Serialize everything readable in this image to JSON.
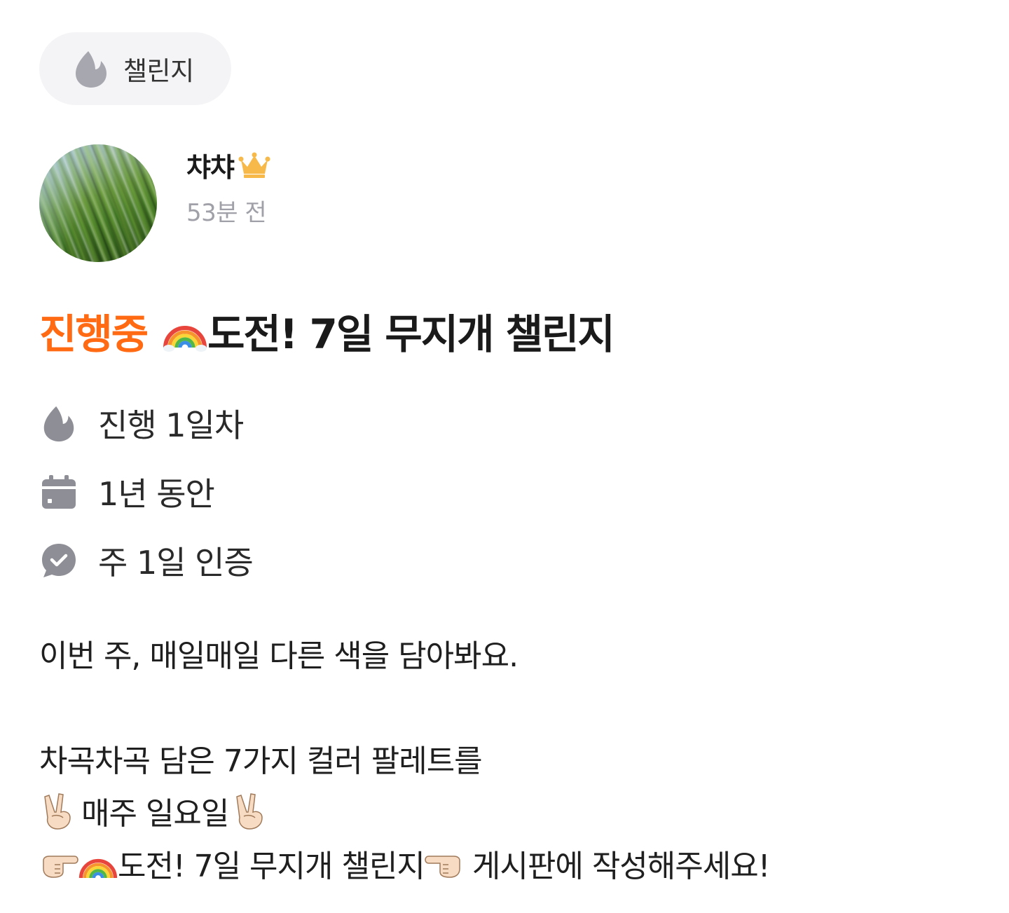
{
  "category": {
    "icon": "flame-icon",
    "label": "챌린지"
  },
  "author": {
    "name": "챠챠",
    "badge_icon": "crown-icon",
    "time": "53분 전"
  },
  "title": {
    "status": "진행중",
    "emoji": "rainbow-icon",
    "text": "도전! 7일 무지개 챌린지"
  },
  "info": {
    "progress": "진행 1일차",
    "duration": "1년 동안",
    "verification": "주 1일 인증"
  },
  "description": {
    "line1": "이번 주, 매일매일 다른 색을 담아봐요.",
    "line2": "차곡차곡 담은 7가지 컬러 팔레트를",
    "line3": "매주 일요일",
    "line4_board": "도전! 7일 무지개 챌린지",
    "line4_end": "게시판에 작성해주세요!"
  },
  "colors": {
    "accent": "#ff6a13",
    "icon_gray": "#8e8e96",
    "crown": "#f6b94a"
  }
}
